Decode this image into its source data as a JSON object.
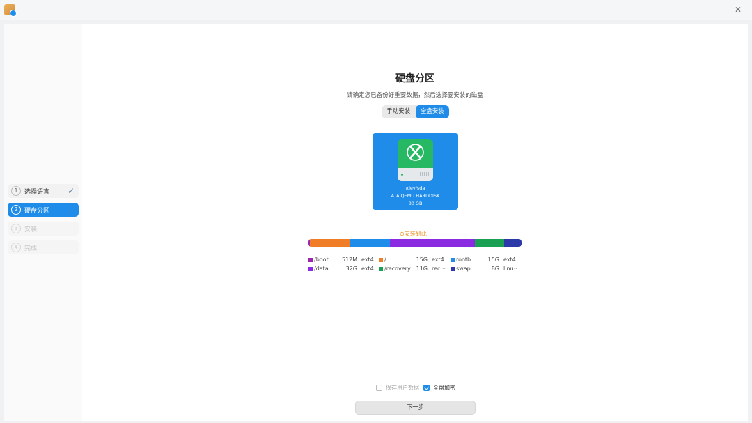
{
  "window": {
    "app_icon": "installer-app-icon",
    "close_icon": "close-icon",
    "close_glyph": "✕"
  },
  "sidebar": {
    "steps": [
      {
        "num": "1",
        "label": "选择语言",
        "state": "done",
        "check": "✓"
      },
      {
        "num": "2",
        "label": "硬盘分区",
        "state": "active"
      },
      {
        "num": "3",
        "label": "安装",
        "state": "disabled"
      },
      {
        "num": "4",
        "label": "完成",
        "state": "disabled"
      }
    ]
  },
  "main": {
    "title": "硬盘分区",
    "subtitle": "请确定您已备份好重要数据，然后选择要安装的磁盘",
    "tabs": [
      {
        "label": "手动安装",
        "active": false
      },
      {
        "label": "全盘安装",
        "active": true
      }
    ],
    "disk": {
      "icon": "hard-disk-icon",
      "device": "/dev/sda",
      "model": "ATA QEMU HARDDISK",
      "size": "80 GB"
    },
    "install_here": "⊙安装到此",
    "partitions": [
      {
        "name": "/boot",
        "size": "512M",
        "fs": "ext4",
        "color": "#9b27af"
      },
      {
        "name": "/",
        "size": "15G",
        "fs": "ext4",
        "color": "#f07d28"
      },
      {
        "name": "rootb",
        "size": "15G",
        "fs": "ext4",
        "color": "#1e8ce8"
      },
      {
        "name": "/data",
        "size": "32G",
        "fs": "ext4",
        "color": "#8a2be2"
      },
      {
        "name": "/recovery",
        "size": "11G",
        "fs": "rec···",
        "color": "#1aa053"
      },
      {
        "name": "swap",
        "size": "8G",
        "fs": "linu···",
        "color": "#2b3aa8"
      }
    ],
    "bar_segments": [
      {
        "partition": "/boot",
        "fraction": 0.006,
        "color": "#9b27af"
      },
      {
        "partition": "/",
        "fraction": 0.1875,
        "color": "#f07d28"
      },
      {
        "partition": "rootb",
        "fraction": 0.1875,
        "color": "#1e8ce8"
      },
      {
        "partition": "/data",
        "fraction": 0.4,
        "color": "#8a2be2"
      },
      {
        "partition": "/recovery",
        "fraction": 0.1375,
        "color": "#1aa053"
      },
      {
        "partition": "swap",
        "fraction": 0.08,
        "color": "#2b3aa8"
      }
    ],
    "options": {
      "keep_user_data": {
        "label": "保存用户数据",
        "checked": false
      },
      "full_disk_encrypt": {
        "label": "全盘加密",
        "checked": true
      }
    },
    "next_label": "下一步"
  }
}
